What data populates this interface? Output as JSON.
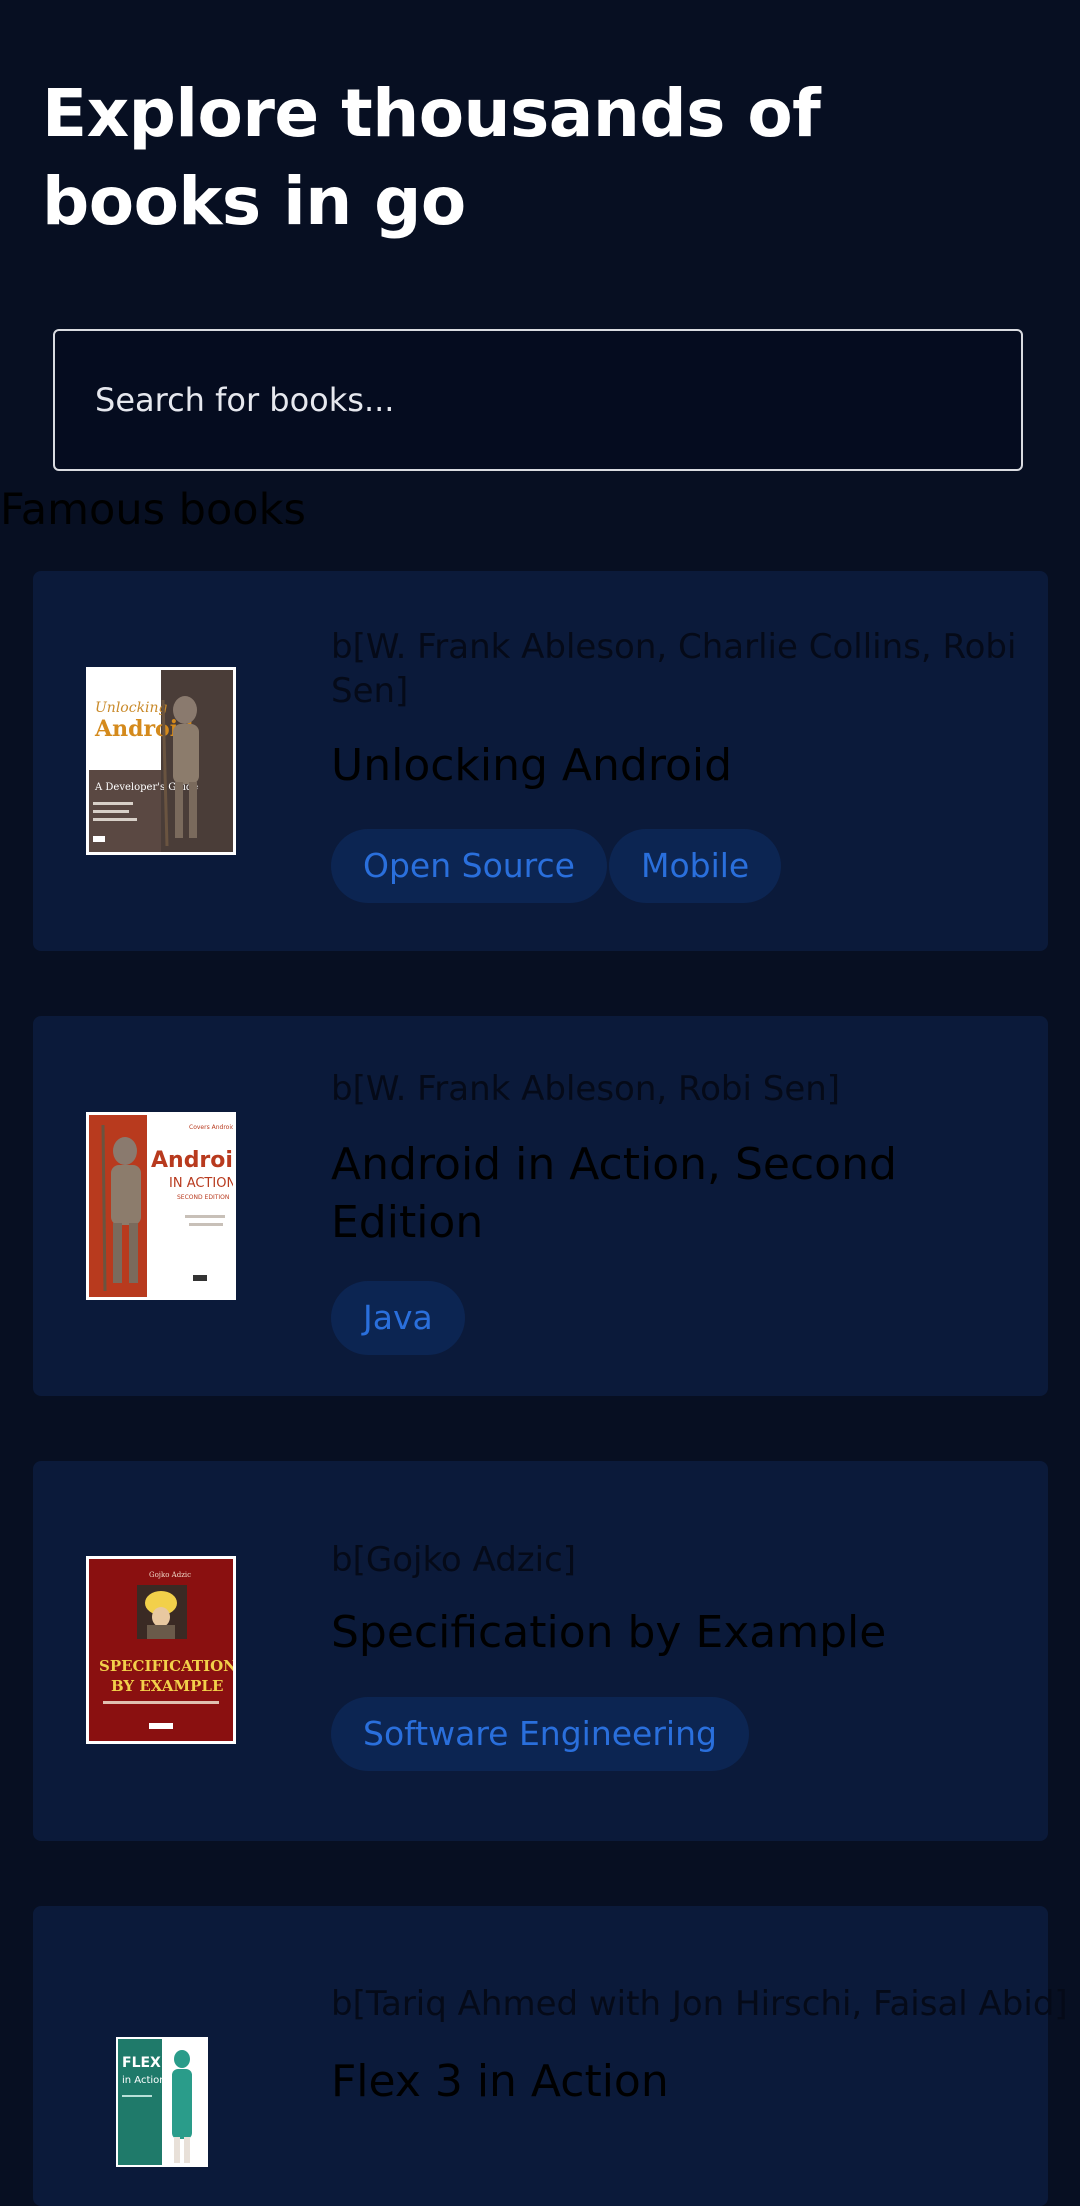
{
  "hero": {
    "title": "Explore thousands of books in go"
  },
  "search": {
    "placeholder": "Search for books..."
  },
  "famous": {
    "heading": "Famous books"
  },
  "books": [
    {
      "authors": "b[W. Frank Ableson, Charlie Collins, Robi Sen]",
      "title": "Unlocking Android",
      "tags": [
        "Open Source",
        "Mobile"
      ],
      "cover": {
        "icon": "unlocking-android-cover",
        "colors": [
          "#ffffff",
          "#4a3a35",
          "#d48a1c"
        ]
      }
    },
    {
      "authors": "b[W. Frank Ableson, Robi Sen]",
      "title": "Android in Action, Second Edition",
      "tags": [
        "Java"
      ],
      "cover": {
        "icon": "android-in-action-cover",
        "colors": [
          "#b83a1e",
          "#ffffff",
          "#b83a1e"
        ]
      }
    },
    {
      "authors": "b[Gojko Adzic]",
      "title": "Specification by Example",
      "tags": [
        "Software Engineering"
      ],
      "cover": {
        "icon": "specification-by-example-cover",
        "colors": [
          "#8a1010",
          "#f2d04a",
          "#ffffff"
        ]
      }
    },
    {
      "authors": "b[Tariq Ahmed with Jon Hirschi, Faisal Abid]",
      "title": "Flex 3 in Action",
      "tags": [],
      "cover": {
        "icon": "flex-3-in-action-cover",
        "colors": [
          "#1f7a6a",
          "#ffffff",
          "#2a9c8a"
        ]
      }
    }
  ],
  "colors": {
    "background": "#070f22",
    "card": "#0b1a3a",
    "tag_bg": "#0c2552",
    "tag_text": "#2a6fdc"
  }
}
